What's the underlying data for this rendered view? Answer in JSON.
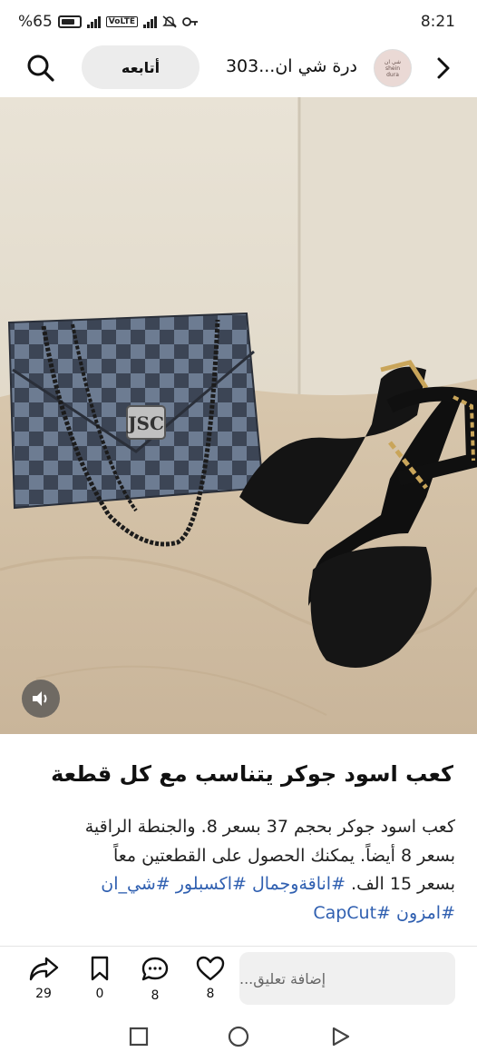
{
  "status_bar": {
    "battery": "%65",
    "network": "VoLTE",
    "time": "8:21"
  },
  "header": {
    "page_name": "درة شي ان...303",
    "avatar_text_top": "شي ان",
    "avatar_text_bottom": "shein\ndura",
    "follow_label": "أتابعه"
  },
  "post": {
    "title": "كعب اسود جوكر يتناسب مع كل قطعة",
    "body_line1": "كعب اسود جوكر بحجم 37 بسعر 8. والجنطة الراقية",
    "body_line2": "بسعر 8 أيضاً. يمكنك الحصول على القطعتين معاً",
    "body_line3_text": "بسعر 15 الف. ",
    "body_line3_tags": "#اناقةوجمال #اكسبلور #شي_ان",
    "body_line4_tags": "#امزون #CapCut"
  },
  "actions": {
    "share_count": "29",
    "save_count": "0",
    "comment_count": "8",
    "like_count": "8",
    "comment_placeholder": "إضافة تعليق..."
  },
  "colors": {
    "hashtag": "#2f5fb0",
    "follow_bg": "#ececec"
  }
}
